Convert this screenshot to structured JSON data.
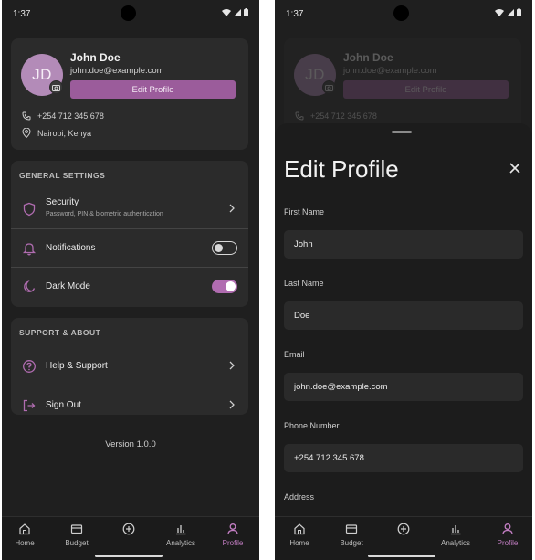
{
  "status_bar": {
    "time": "1:37"
  },
  "profile": {
    "initials": "JD",
    "name": "John Doe",
    "email": "john.doe@example.com",
    "edit_button": "Edit Profile",
    "phone": "+254 712 345 678",
    "location": "Nairobi, Kenya",
    "avatar_color": "#b38bb8",
    "accent_color": "#9b5c9b"
  },
  "general_settings": {
    "header": "GENERAL SETTINGS",
    "items": [
      {
        "label": "Security",
        "subtitle": "Password, PIN & biometric authentication",
        "icon": "shield-icon",
        "type": "link"
      },
      {
        "label": "Notifications",
        "icon": "bell-icon",
        "type": "toggle",
        "enabled": false
      },
      {
        "label": "Dark Mode",
        "icon": "moon-icon",
        "type": "toggle",
        "enabled": true
      }
    ]
  },
  "support": {
    "header": "SUPPORT & ABOUT",
    "items": [
      {
        "label": "Help & Support",
        "icon": "help-circle-icon"
      },
      {
        "label": "Sign Out",
        "icon": "sign-out-icon"
      }
    ]
  },
  "version": "Version 1.0.0",
  "nav": {
    "items": [
      {
        "label": "Home",
        "icon": "home-icon"
      },
      {
        "label": "Budget",
        "icon": "wallet-icon"
      },
      {
        "label": "",
        "icon": "add-circle-icon"
      },
      {
        "label": "Analytics",
        "icon": "bar-chart-icon"
      },
      {
        "label": "Profile",
        "icon": "person-icon",
        "active": true
      }
    ]
  },
  "edit_sheet": {
    "title": "Edit Profile",
    "fields": [
      {
        "label": "First Name",
        "value": "John"
      },
      {
        "label": "Last Name",
        "value": "Doe"
      },
      {
        "label": "Email",
        "value": "john.doe@example.com"
      },
      {
        "label": "Phone Number",
        "value": "+254 712 345 678"
      },
      {
        "label": "Address",
        "value": ""
      }
    ]
  }
}
